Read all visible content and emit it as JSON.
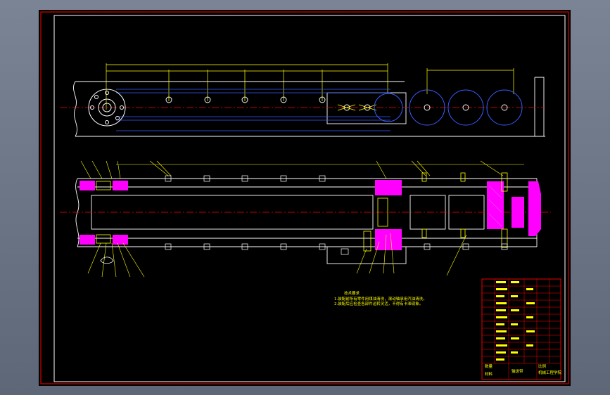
{
  "drawing": {
    "colors": {
      "background": "#000000",
      "frame": "#ff0000",
      "outline": "#ffffff",
      "dimension": "#ffff00",
      "centerline": "#ff0000",
      "hidden": "#3a5cff",
      "section_hatch": "#ff00ff",
      "leader": "#ffff00"
    },
    "notes": {
      "heading": "技术要求",
      "line1": "1.装配前所有零件用煤油清洗，滚动轴承用汽油清洗。",
      "line2": "2.装配后应检查各部件运转灵活，不得有卡滞现象。"
    },
    "title_block": {
      "drawing_title": "输送带",
      "company": "机械工程学院",
      "scale_label": "比例",
      "qty_label": "数量",
      "material_label": "材料"
    }
  }
}
